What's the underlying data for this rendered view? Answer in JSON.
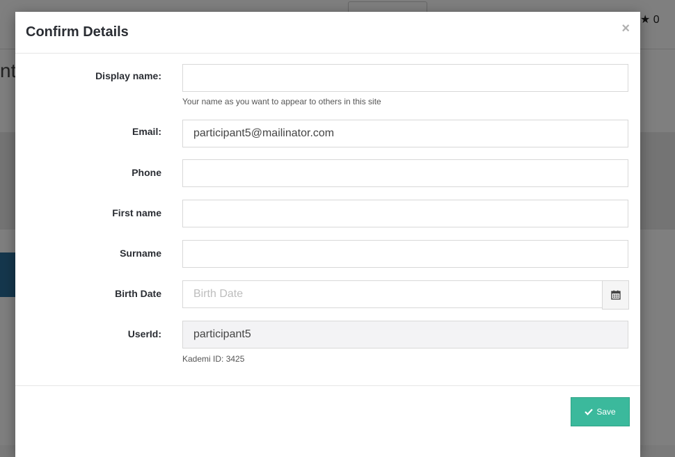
{
  "background": {
    "partial_heading": "nte",
    "rating_icon": "star-icon",
    "rating_value": "0"
  },
  "modal": {
    "title": "Confirm Details",
    "close_symbol": "×",
    "fields": {
      "display_name": {
        "label": "Display name:",
        "value": "",
        "help": "Your name as you want to appear to others in this site"
      },
      "email": {
        "label": "Email:",
        "value": "participant5@mailinator.com"
      },
      "phone": {
        "label": "Phone",
        "value": ""
      },
      "first_name": {
        "label": "First name",
        "value": ""
      },
      "surname": {
        "label": "Surname",
        "value": ""
      },
      "birth_date": {
        "label": "Birth Date",
        "value": "",
        "placeholder": "Birth Date",
        "addon_icon": "calendar-icon"
      },
      "user_id": {
        "label": "UserId:",
        "value": "participant5",
        "help": "Kademi ID: 3425"
      }
    },
    "save_button": {
      "label": "Save",
      "icon": "check-icon",
      "color": "#3bb99c"
    }
  }
}
